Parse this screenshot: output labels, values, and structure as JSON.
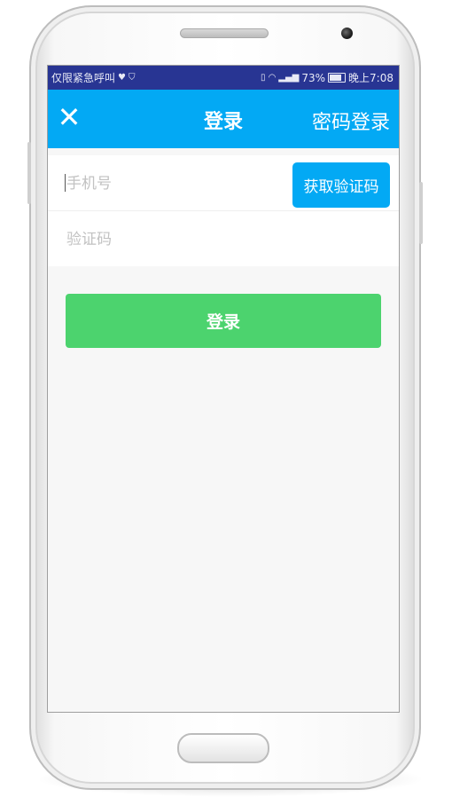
{
  "statusbar": {
    "left_text": "仅限紧急呼叫",
    "heart_icon": "heart-icon",
    "shield_icon": "shield-icon",
    "battery_percent": "73%",
    "time": "晚上7:08"
  },
  "appbar": {
    "close_icon": "close-icon",
    "title": "登录",
    "password_login": "密码登录",
    "color": "#03a9f4"
  },
  "form": {
    "phone_placeholder": "手机号",
    "code_placeholder": "验证码",
    "get_code_label": "获取验证码"
  },
  "login_button": {
    "label": "登录",
    "color": "#4cd36e"
  }
}
